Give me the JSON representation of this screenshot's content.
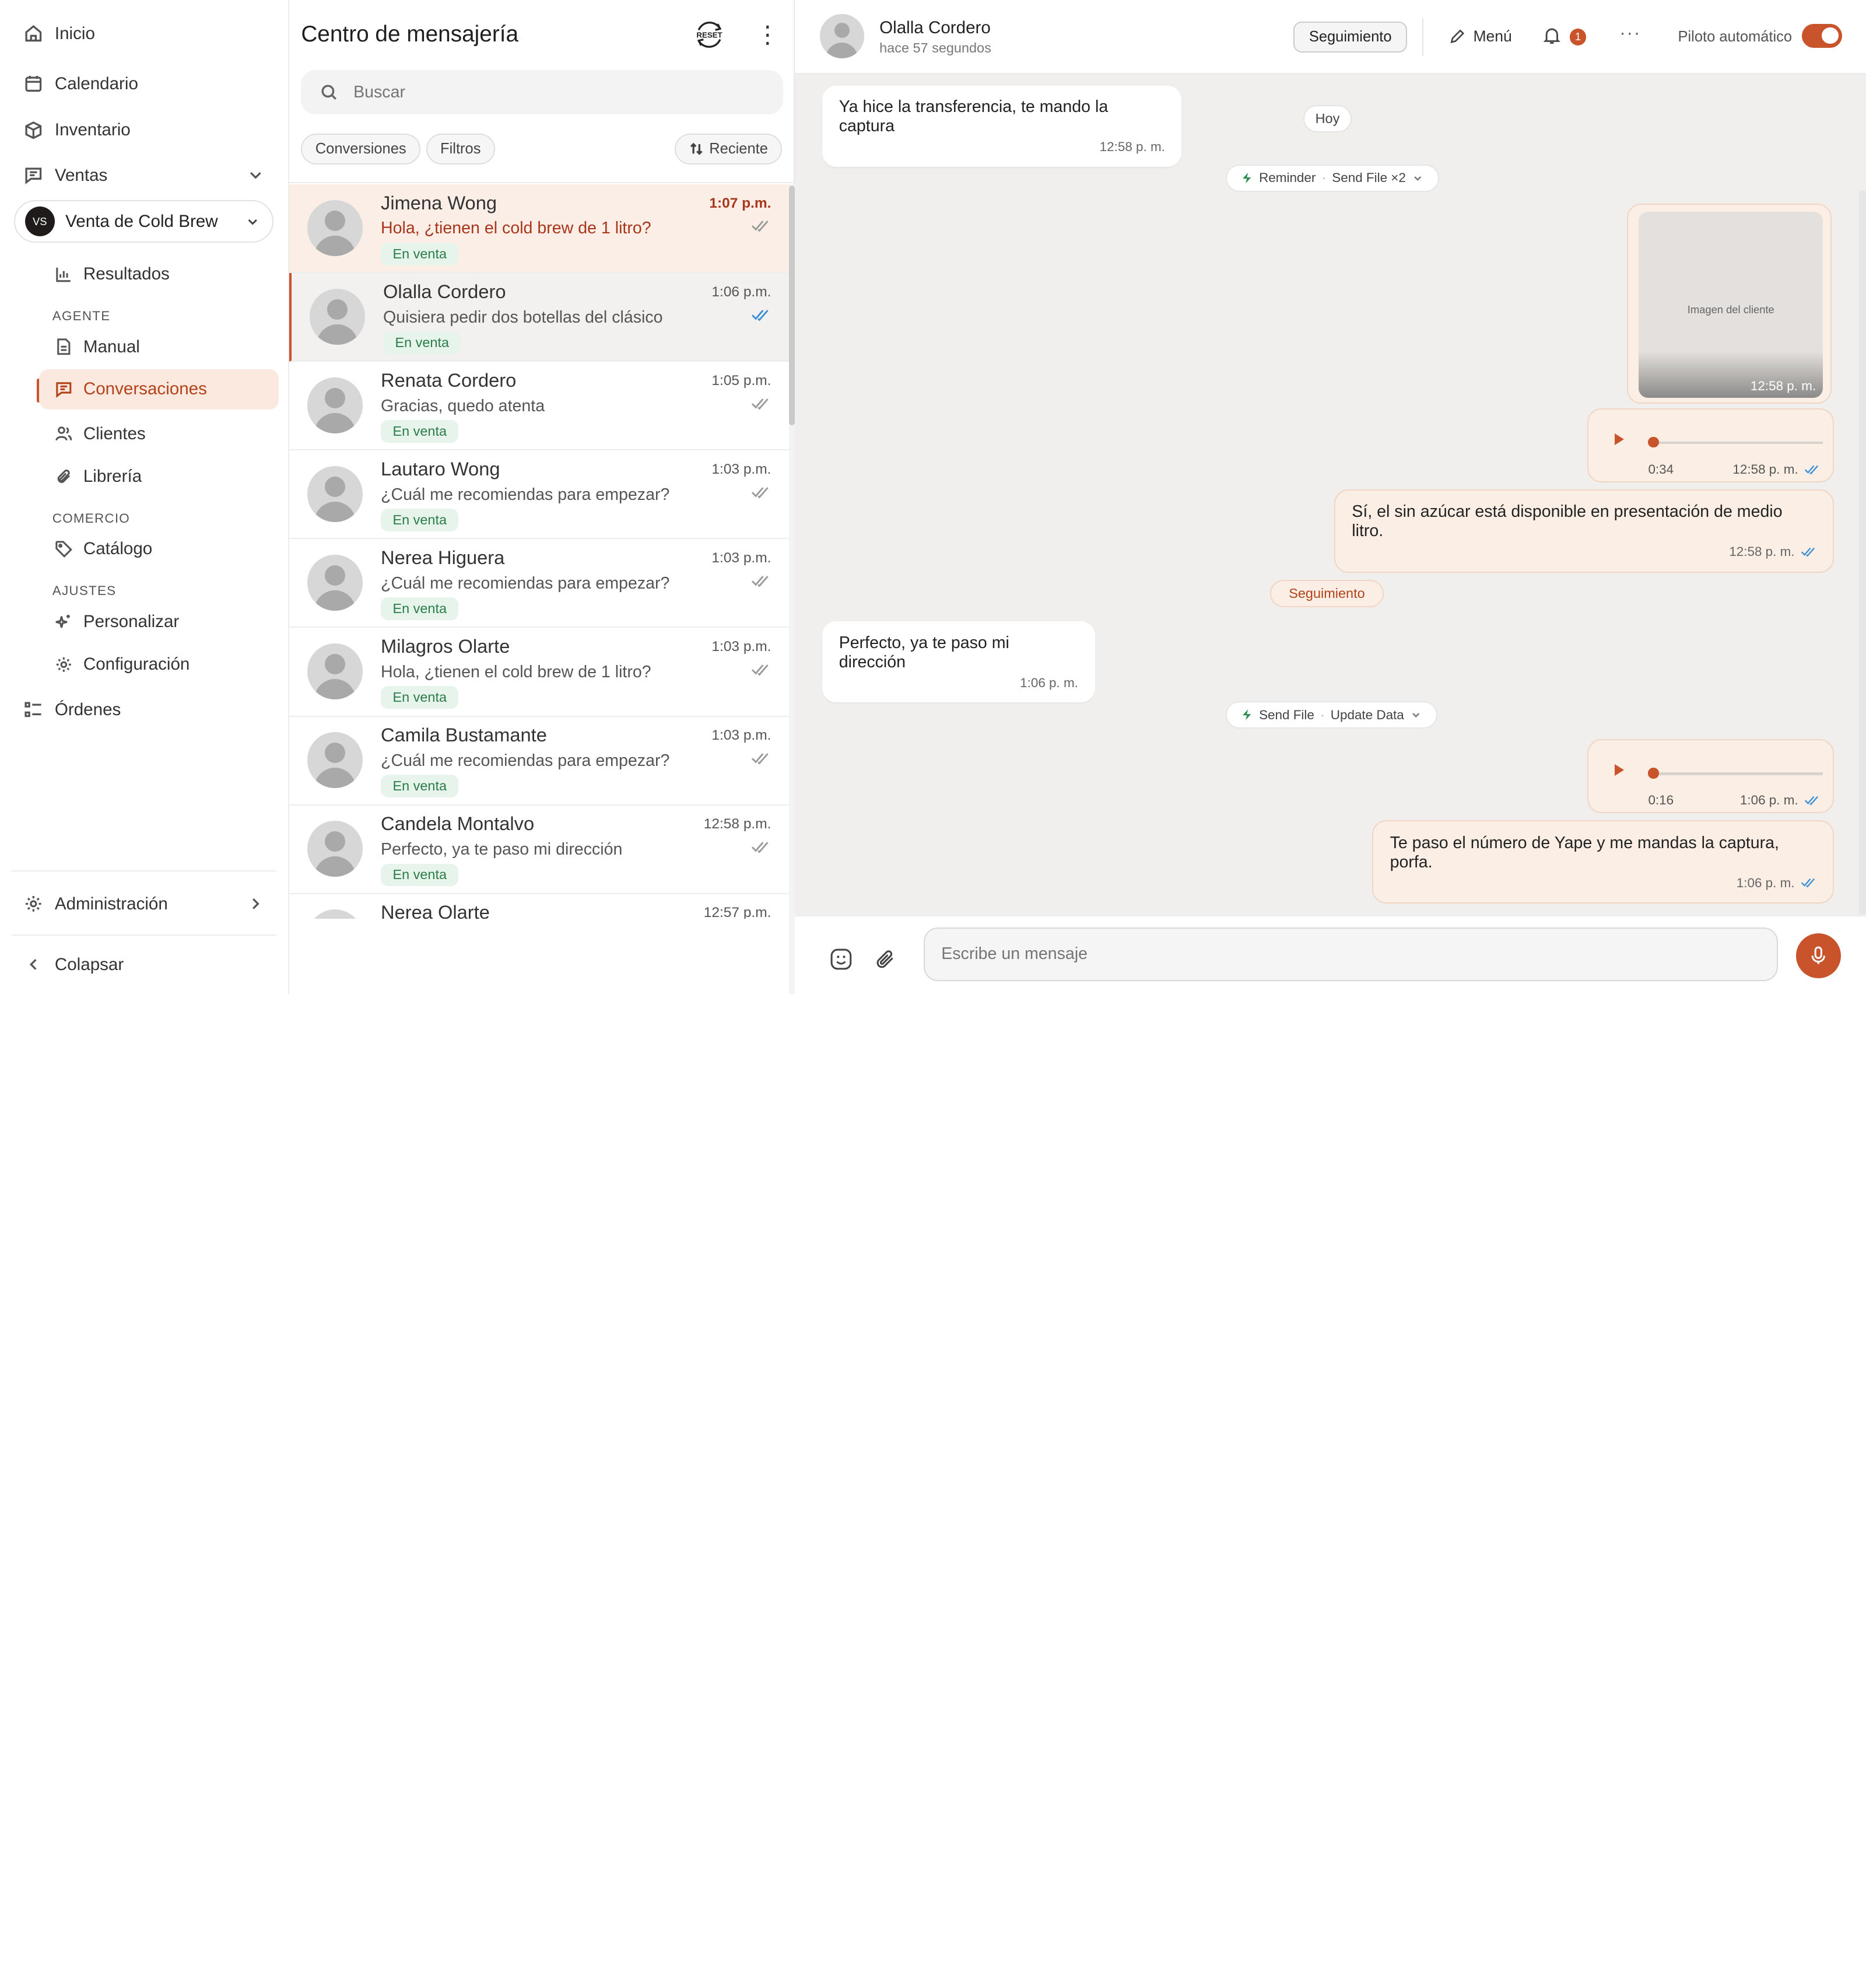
{
  "nav": {
    "inicio": "Inicio",
    "calendario": "Calendario",
    "inventario": "Inventario",
    "ventas": "Ventas",
    "workspace_initials": "VS",
    "workspace_name": "Venta de Cold Brew",
    "resultados": "Resultados",
    "section_agente": "AGENTE",
    "manual": "Manual",
    "conversaciones": "Conversaciones",
    "clientes": "Clientes",
    "libreria": "Librería",
    "section_comercio": "COMERCIO",
    "catalogo": "Catálogo",
    "section_ajustes": "AJUSTES",
    "personalizar": "Personalizar",
    "configuracion": "Configuración",
    "ordenes": "Órdenes",
    "administracion": "Administración",
    "colapsar": "Colapsar"
  },
  "inbox": {
    "title": "Centro de mensajería",
    "reset_label": "RESET",
    "search_placeholder": "Buscar",
    "filter_conversions": "Conversiones",
    "filter_filters": "Filtros",
    "sort_label": "Reciente"
  },
  "conversations": [
    {
      "name": "Jimena Wong",
      "message": "Hola, ¿tienen el cold brew de 1 litro?",
      "time": "1:07 p.m.",
      "tag": "En venta",
      "read": false
    },
    {
      "name": "Olalla Cordero",
      "message": "Quisiera pedir dos botellas del clásico",
      "time": "1:06 p.m.",
      "tag": "En venta",
      "read": true
    },
    {
      "name": "Renata Cordero",
      "message": "Gracias, quedo atenta",
      "time": "1:05 p.m.",
      "tag": "En venta",
      "read": false
    },
    {
      "name": "Lautaro Wong",
      "message": "¿Cuál me recomiendas para empezar?",
      "time": "1:03 p.m.",
      "tag": "En venta",
      "read": false
    },
    {
      "name": "Nerea Higuera",
      "message": "¿Cuál me recomiendas para empezar?",
      "time": "1:03 p.m.",
      "tag": "En venta",
      "read": false
    },
    {
      "name": "Milagros Olarte",
      "message": "Hola, ¿tienen el cold brew de 1 litro?",
      "time": "1:03 p.m.",
      "tag": "En venta",
      "read": false
    },
    {
      "name": "Camila Bustamante",
      "message": "¿Cuál me recomiendas para empezar?",
      "time": "1:03 p.m.",
      "tag": "En venta",
      "read": false
    },
    {
      "name": "Candela Montalvo",
      "message": "Perfecto, ya te paso mi dirección",
      "time": "12:58 p.m.",
      "tag": "En venta",
      "read": false
    },
    {
      "name": "Nerea Olarte",
      "message": "",
      "time": "12:57 p.m.",
      "tag": "",
      "read": false
    }
  ],
  "chat": {
    "contact_name": "Olalla Cordero",
    "last_seen": "hace 57 segundos",
    "follow_button": "Seguimiento",
    "menu_label": "Menú",
    "notif_count": "1",
    "autopilot_label": "Piloto automático",
    "msg1_text": "Ya hice la transferencia, te mando la captura",
    "msg1_time": "12:58 p. m.",
    "day_label": "Hoy",
    "action1_a": "Reminder",
    "action1_b": "Send File ×2",
    "image_caption": "Imagen del cliente",
    "image_time": "12:58 p. m.",
    "audio1_dur": "0:34",
    "audio1_time": "12:58 p. m.",
    "msg2_text": "Sí, el sin azúcar está disponible en presentación de medio litro.",
    "msg2_time": "12:58 p. m.",
    "follow_pill": "Seguimiento",
    "msg3_text": "Perfecto, ya te paso mi dirección",
    "msg3_time": "1:06 p. m.",
    "action2_a": "Send File",
    "action2_b": "Update Data",
    "audio2_dur": "0:16",
    "audio2_time": "1:06 p. m.",
    "msg4_text": "Te paso el número de Yape y me mandas la captura, porfa.",
    "msg4_time": "1:06 p. m.",
    "composer_placeholder": "Escribe un mensaje"
  },
  "colors": {
    "accent": "#c9532b",
    "accent_text": "#b3421a",
    "tag_bg": "#e7f4ec",
    "tag_text": "#2a7c48",
    "read_check": "#3b8fd6"
  }
}
